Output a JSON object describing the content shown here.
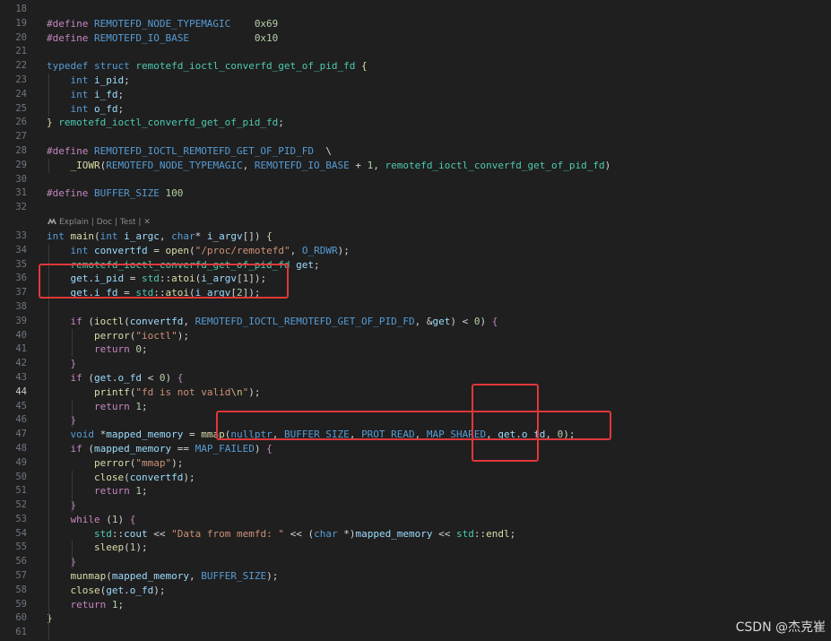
{
  "editor": {
    "lines": [
      {
        "n": "18",
        "tokens": []
      },
      {
        "n": "19",
        "tokens": [
          [
            "pp",
            "#define"
          ],
          [
            "",
            ""
          ],
          [
            "mac",
            " REMOTEFD_NODE_TYPEMAGIC"
          ],
          [
            "",
            "    "
          ],
          [
            "num",
            "0x69"
          ]
        ]
      },
      {
        "n": "20",
        "tokens": [
          [
            "pp",
            "#define"
          ],
          [
            "mac",
            " REMOTEFD_IO_BASE"
          ],
          [
            "",
            "           "
          ],
          [
            "num",
            "0x10"
          ]
        ]
      },
      {
        "n": "21",
        "tokens": []
      },
      {
        "n": "22",
        "tokens": [
          [
            "kw",
            "typedef"
          ],
          [
            "",
            " "
          ],
          [
            "kw",
            "struct"
          ],
          [
            "",
            " "
          ],
          [
            "ty",
            "remotefd_ioctl_converfd_get_of_pid_fd"
          ],
          [
            "",
            " "
          ],
          [
            "fn",
            "{"
          ]
        ]
      },
      {
        "n": "23",
        "tokens": [
          [
            "",
            "    "
          ],
          [
            "kw",
            "int"
          ],
          [
            "",
            " "
          ],
          [
            "var",
            "i_pid"
          ],
          [
            "",
            ";"
          ]
        ]
      },
      {
        "n": "24",
        "tokens": [
          [
            "",
            "    "
          ],
          [
            "kw",
            "int"
          ],
          [
            "",
            " "
          ],
          [
            "var",
            "i_fd"
          ],
          [
            "",
            ";"
          ]
        ]
      },
      {
        "n": "25",
        "tokens": [
          [
            "",
            "    "
          ],
          [
            "kw",
            "int"
          ],
          [
            "",
            " "
          ],
          [
            "var",
            "o_fd"
          ],
          [
            "",
            ";"
          ]
        ]
      },
      {
        "n": "26",
        "tokens": [
          [
            "fn",
            "}"
          ],
          [
            "",
            " "
          ],
          [
            "ty",
            "remotefd_ioctl_converfd_get_of_pid_fd"
          ],
          [
            "",
            ";"
          ]
        ]
      },
      {
        "n": "27",
        "tokens": []
      },
      {
        "n": "28",
        "tokens": [
          [
            "pp",
            "#define"
          ],
          [
            "",
            " "
          ],
          [
            "mac",
            "REMOTEFD_IOCTL_REMOTEFD_GET_OF_PID_FD"
          ],
          [
            "",
            "  \\"
          ]
        ]
      },
      {
        "n": "29",
        "tokens": [
          [
            "",
            "    "
          ],
          [
            "fn",
            "_IOWR"
          ],
          [
            "",
            "("
          ],
          [
            "mac",
            "REMOTEFD_NODE_TYPEMAGIC"
          ],
          [
            "",
            ", "
          ],
          [
            "mac",
            "REMOTEFD_IO_BASE"
          ],
          [
            "",
            " + "
          ],
          [
            "num",
            "1"
          ],
          [
            "",
            ", "
          ],
          [
            "ty",
            "remotefd_ioctl_converfd_get_of_pid_fd"
          ],
          [
            "",
            ")"
          ]
        ]
      },
      {
        "n": "30",
        "tokens": []
      },
      {
        "n": "31",
        "tokens": [
          [
            "pp",
            "#define"
          ],
          [
            "",
            " "
          ],
          [
            "mac",
            "BUFFER_SIZE"
          ],
          [
            "",
            " "
          ],
          [
            "num",
            "100"
          ]
        ]
      },
      {
        "n": "32",
        "tokens": []
      },
      {
        "n": "",
        "lens": "Explain | Doc | Test | ✕"
      },
      {
        "n": "33",
        "tokens": [
          [
            "kw",
            "int"
          ],
          [
            "",
            " "
          ],
          [
            "fn",
            "main"
          ],
          [
            "",
            "("
          ],
          [
            "kw",
            "int"
          ],
          [
            "",
            " "
          ],
          [
            "var",
            "i_argc"
          ],
          [
            "",
            ", "
          ],
          [
            "kw",
            "char"
          ],
          [
            "",
            "* "
          ],
          [
            "var",
            "i_argv"
          ],
          [
            "",
            "[]) "
          ],
          [
            "fn",
            "{"
          ]
        ]
      },
      {
        "n": "34",
        "tokens": [
          [
            "",
            "    "
          ],
          [
            "kw",
            "int"
          ],
          [
            "",
            " "
          ],
          [
            "var",
            "convertfd"
          ],
          [
            "",
            " = "
          ],
          [
            "fn",
            "open"
          ],
          [
            "",
            "("
          ],
          [
            "str",
            "\"/proc/remotefd\""
          ],
          [
            "",
            ", "
          ],
          [
            "mac",
            "O_RDWR"
          ],
          [
            "",
            ");"
          ]
        ]
      },
      {
        "n": "35",
        "tokens": [
          [
            "",
            "    "
          ],
          [
            "ty",
            "remotefd_ioctl_converfd_get_of_pid_fd"
          ],
          [
            "",
            " "
          ],
          [
            "var",
            "get"
          ],
          [
            "",
            ";"
          ]
        ]
      },
      {
        "n": "36",
        "tokens": [
          [
            "",
            "    "
          ],
          [
            "var",
            "get"
          ],
          [
            "",
            "."
          ],
          [
            "var",
            "i_pid"
          ],
          [
            "",
            " = "
          ],
          [
            "ns",
            "std"
          ],
          [
            "",
            "::"
          ],
          [
            "fn",
            "atoi"
          ],
          [
            "",
            "("
          ],
          [
            "var",
            "i_argv"
          ],
          [
            "",
            "["
          ],
          [
            "num",
            "1"
          ],
          [
            "",
            "]);"
          ]
        ]
      },
      {
        "n": "37",
        "tokens": [
          [
            "",
            "    "
          ],
          [
            "var",
            "get"
          ],
          [
            "",
            "."
          ],
          [
            "var",
            "i_fd"
          ],
          [
            "",
            " = "
          ],
          [
            "ns",
            "std"
          ],
          [
            "",
            "::"
          ],
          [
            "fn",
            "atoi"
          ],
          [
            "",
            "("
          ],
          [
            "var",
            "i_argv"
          ],
          [
            "",
            "["
          ],
          [
            "num",
            "2"
          ],
          [
            "",
            "]);"
          ]
        ]
      },
      {
        "n": "38",
        "tokens": []
      },
      {
        "n": "39",
        "tokens": [
          [
            "",
            "    "
          ],
          [
            "ctl",
            "if"
          ],
          [
            "",
            " ("
          ],
          [
            "fn",
            "ioctl"
          ],
          [
            "",
            "("
          ],
          [
            "var",
            "convertfd"
          ],
          [
            "",
            ", "
          ],
          [
            "mac",
            "REMOTEFD_IOCTL_REMOTEFD_GET_OF_PID_FD"
          ],
          [
            "",
            ", &"
          ],
          [
            "var",
            "get"
          ],
          [
            "",
            ") < "
          ],
          [
            "num",
            "0"
          ],
          [
            "",
            ") "
          ],
          [
            "ctl",
            "{"
          ]
        ]
      },
      {
        "n": "40",
        "tokens": [
          [
            "",
            "        "
          ],
          [
            "fn",
            "perror"
          ],
          [
            "",
            "("
          ],
          [
            "str",
            "\"ioctl\""
          ],
          [
            "",
            ");"
          ]
        ]
      },
      {
        "n": "41",
        "tokens": [
          [
            "",
            "        "
          ],
          [
            "ctl",
            "return"
          ],
          [
            "",
            " "
          ],
          [
            "num",
            "0"
          ],
          [
            "",
            ";"
          ]
        ]
      },
      {
        "n": "42",
        "tokens": [
          [
            "",
            "    "
          ],
          [
            "ctl",
            "}"
          ]
        ]
      },
      {
        "n": "43",
        "tokens": [
          [
            "",
            "    "
          ],
          [
            "ctl",
            "if"
          ],
          [
            "",
            " ("
          ],
          [
            "var",
            "get"
          ],
          [
            "",
            "."
          ],
          [
            "var",
            "o_fd"
          ],
          [
            "",
            " < "
          ],
          [
            "num",
            "0"
          ],
          [
            "",
            ") "
          ],
          [
            "ctl",
            "{"
          ]
        ]
      },
      {
        "n": "44",
        "active": true,
        "tokens": [
          [
            "",
            "        "
          ],
          [
            "fn",
            "printf"
          ],
          [
            "",
            "("
          ],
          [
            "str",
            "\"fd is not valid"
          ],
          [
            "esc",
            "\\n"
          ],
          [
            "str",
            "\""
          ],
          [
            "",
            ");"
          ]
        ]
      },
      {
        "n": "45",
        "tokens": [
          [
            "",
            "        "
          ],
          [
            "ctl",
            "return"
          ],
          [
            "",
            " "
          ],
          [
            "num",
            "1"
          ],
          [
            "",
            ";"
          ]
        ]
      },
      {
        "n": "46",
        "tokens": [
          [
            "",
            "    "
          ],
          [
            "ctl",
            "}"
          ]
        ]
      },
      {
        "n": "47",
        "tokens": [
          [
            "",
            "    "
          ],
          [
            "kw",
            "void"
          ],
          [
            "",
            " *"
          ],
          [
            "var",
            "mapped_memory"
          ],
          [
            "",
            " = "
          ],
          [
            "fn",
            "mmap"
          ],
          [
            "",
            "("
          ],
          [
            "kw",
            "nullptr"
          ],
          [
            "",
            ", "
          ],
          [
            "mac",
            "BUFFER_SIZE"
          ],
          [
            "",
            ", "
          ],
          [
            "mac",
            "PROT_READ"
          ],
          [
            "",
            ", "
          ],
          [
            "mac",
            "MAP_SHARED"
          ],
          [
            "",
            ", "
          ],
          [
            "var",
            "get"
          ],
          [
            "",
            "."
          ],
          [
            "var",
            "o_fd"
          ],
          [
            "",
            ", "
          ],
          [
            "num",
            "0"
          ],
          [
            "",
            ");"
          ]
        ]
      },
      {
        "n": "48",
        "tokens": [
          [
            "",
            "    "
          ],
          [
            "ctl",
            "if"
          ],
          [
            "",
            " ("
          ],
          [
            "var",
            "mapped_memory"
          ],
          [
            "",
            " == "
          ],
          [
            "mac",
            "MAP_FAILED"
          ],
          [
            "",
            ") "
          ],
          [
            "ctl",
            "{"
          ]
        ]
      },
      {
        "n": "49",
        "tokens": [
          [
            "",
            "        "
          ],
          [
            "fn",
            "perror"
          ],
          [
            "",
            "("
          ],
          [
            "str",
            "\"mmap\""
          ],
          [
            "",
            ");"
          ]
        ]
      },
      {
        "n": "50",
        "tokens": [
          [
            "",
            "        "
          ],
          [
            "fn",
            "close"
          ],
          [
            "",
            "("
          ],
          [
            "var",
            "convertfd"
          ],
          [
            "",
            ");"
          ]
        ]
      },
      {
        "n": "51",
        "tokens": [
          [
            "",
            "        "
          ],
          [
            "ctl",
            "return"
          ],
          [
            "",
            " "
          ],
          [
            "num",
            "1"
          ],
          [
            "",
            ";"
          ]
        ]
      },
      {
        "n": "52",
        "tokens": [
          [
            "",
            "    "
          ],
          [
            "ctl",
            "}"
          ]
        ]
      },
      {
        "n": "53",
        "tokens": [
          [
            "",
            "    "
          ],
          [
            "ctl",
            "while"
          ],
          [
            "",
            " ("
          ],
          [
            "num",
            "1"
          ],
          [
            "",
            ") "
          ],
          [
            "ctl",
            "{"
          ]
        ]
      },
      {
        "n": "54",
        "tokens": [
          [
            "",
            "        "
          ],
          [
            "ns",
            "std"
          ],
          [
            "",
            "::"
          ],
          [
            "var",
            "cout"
          ],
          [
            "",
            " << "
          ],
          [
            "str",
            "\"Data from memfd: \""
          ],
          [
            "",
            " << ("
          ],
          [
            "kw",
            "char"
          ],
          [
            "",
            " *)"
          ],
          [
            "var",
            "mapped_memory"
          ],
          [
            "",
            " << "
          ],
          [
            "ns",
            "std"
          ],
          [
            "",
            "::"
          ],
          [
            "fn",
            "endl"
          ],
          [
            "",
            ";"
          ]
        ]
      },
      {
        "n": "55",
        "tokens": [
          [
            "",
            "        "
          ],
          [
            "fn",
            "sleep"
          ],
          [
            "",
            "("
          ],
          [
            "num",
            "1"
          ],
          [
            "",
            ");"
          ]
        ]
      },
      {
        "n": "56",
        "tokens": [
          [
            "",
            "    "
          ],
          [
            "ctl",
            "}"
          ]
        ]
      },
      {
        "n": "57",
        "tokens": [
          [
            "",
            "    "
          ],
          [
            "fn",
            "munmap"
          ],
          [
            "",
            "("
          ],
          [
            "var",
            "mapped_memory"
          ],
          [
            "",
            ", "
          ],
          [
            "mac",
            "BUFFER_SIZE"
          ],
          [
            "",
            ");"
          ]
        ]
      },
      {
        "n": "58",
        "tokens": [
          [
            "",
            "    "
          ],
          [
            "fn",
            "close"
          ],
          [
            "",
            "("
          ],
          [
            "var",
            "get"
          ],
          [
            "",
            "."
          ],
          [
            "var",
            "o_fd"
          ],
          [
            "",
            ");"
          ]
        ]
      },
      {
        "n": "59",
        "tokens": [
          [
            "",
            "    "
          ],
          [
            "ctl",
            "return"
          ],
          [
            "",
            " "
          ],
          [
            "num",
            "1"
          ],
          [
            "",
            ";"
          ]
        ]
      },
      {
        "n": "60",
        "tokens": [
          [
            "fn",
            "}"
          ]
        ]
      },
      {
        "n": "61",
        "tokens": []
      }
    ]
  },
  "colors": {
    "background": "#1f1f1f",
    "highlight_box": "#e0383a"
  },
  "icons": {
    "codelens": "mintlify-logo-icon"
  },
  "watermark": "CSDN @杰克崔"
}
